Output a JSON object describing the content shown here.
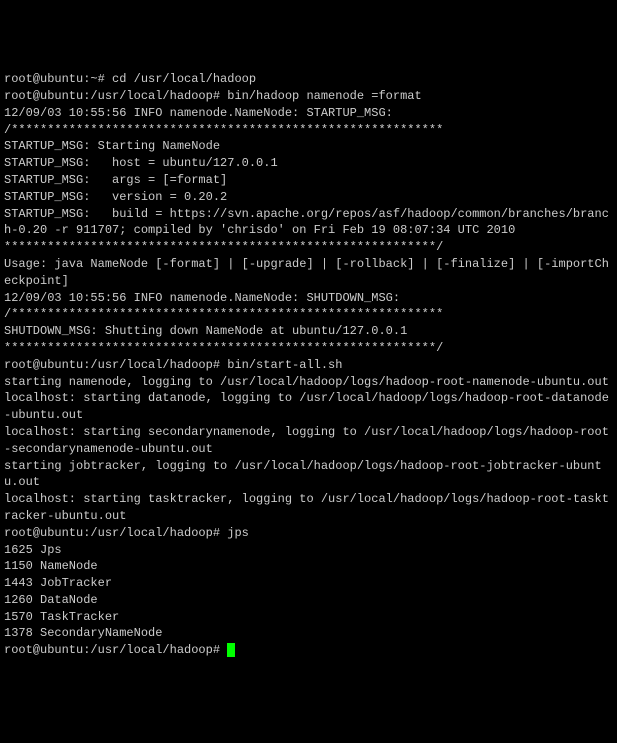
{
  "lines": [
    "root@ubuntu:~# cd /usr/local/hadoop",
    "root@ubuntu:/usr/local/hadoop# bin/hadoop namenode =format",
    "12/09/03 10:55:56 INFO namenode.NameNode: STARTUP_MSG:",
    "/************************************************************",
    "STARTUP_MSG: Starting NameNode",
    "STARTUP_MSG:   host = ubuntu/127.0.0.1",
    "STARTUP_MSG:   args = [=format]",
    "STARTUP_MSG:   version = 0.20.2",
    "STARTUP_MSG:   build = https://svn.apache.org/repos/asf/hadoop/common/branches/branch-0.20 -r 911707; compiled by 'chrisdo' on Fri Feb 19 08:07:34 UTC 2010",
    "************************************************************/",
    "Usage: java NameNode [-format] | [-upgrade] | [-rollback] | [-finalize] | [-importCheckpoint]",
    "12/09/03 10:55:56 INFO namenode.NameNode: SHUTDOWN_MSG:",
    "/************************************************************",
    "SHUTDOWN_MSG: Shutting down NameNode at ubuntu/127.0.0.1",
    "************************************************************/",
    "root@ubuntu:/usr/local/hadoop# bin/start-all.sh",
    "starting namenode, logging to /usr/local/hadoop/logs/hadoop-root-namenode-ubuntu.out",
    "localhost: starting datanode, logging to /usr/local/hadoop/logs/hadoop-root-datanode-ubuntu.out",
    "localhost: starting secondarynamenode, logging to /usr/local/hadoop/logs/hadoop-root-secondarynamenode-ubuntu.out",
    "starting jobtracker, logging to /usr/local/hadoop/logs/hadoop-root-jobtracker-ubuntu.out",
    "localhost: starting tasktracker, logging to /usr/local/hadoop/logs/hadoop-root-tasktracker-ubuntu.out",
    "root@ubuntu:/usr/local/hadoop# jps",
    "1625 Jps",
    "1150 NameNode",
    "1443 JobTracker",
    "1260 DataNode",
    "1570 TaskTracker",
    "1378 SecondaryNameNode"
  ],
  "final_prompt": "root@ubuntu:/usr/local/hadoop# "
}
